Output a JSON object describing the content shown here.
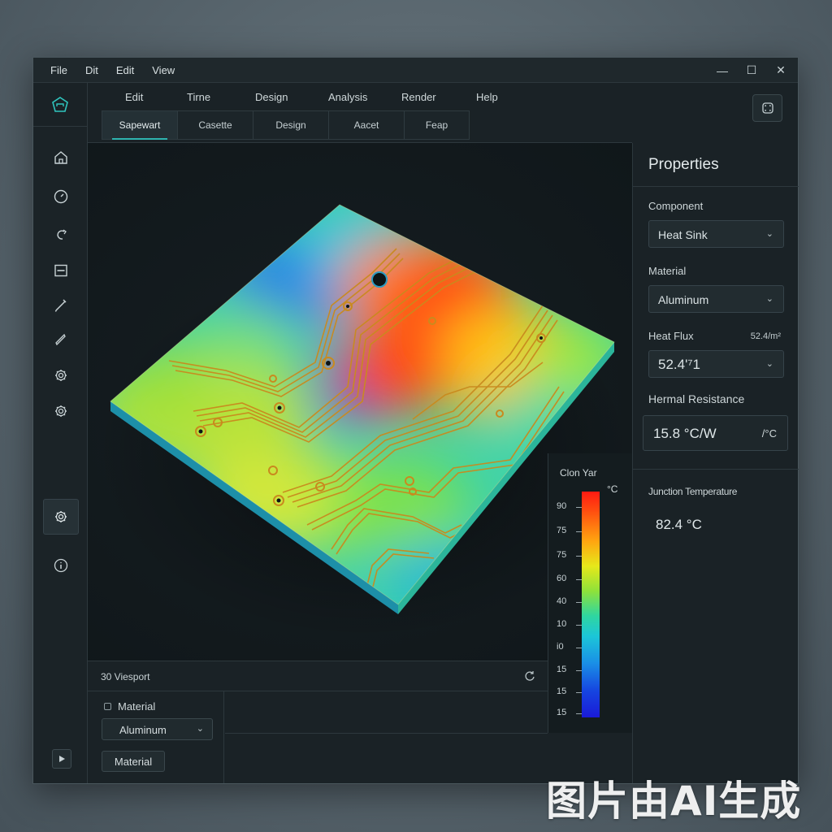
{
  "titlebar": {
    "menu": [
      "File",
      "Dit",
      "Edit",
      "View"
    ],
    "controls": {
      "minimize": "—",
      "maximize": "☐",
      "close": "✕"
    }
  },
  "topmenu": [
    "Edit",
    "Tirne",
    "Design",
    "Analysis",
    "Render",
    "Help"
  ],
  "tabs": [
    "Sapewart",
    "Casette",
    "Design",
    "Aacet",
    "Feap"
  ],
  "active_tab": 0,
  "sidebar": {
    "icons": [
      "home-icon",
      "gauge-icon",
      "hook-icon",
      "panel-icon",
      "pen-icon",
      "pencil-icon",
      "gear-icon",
      "settings-icon",
      "active-settings-icon",
      "info-icon"
    ]
  },
  "viewport": {
    "footer_label": "30 Viesport"
  },
  "colorbar": {
    "title": "Clon Yar",
    "unit": "°C",
    "ticks": [
      "90",
      "75",
      "75",
      "60",
      "40",
      "10",
      "i0",
      "15",
      "15",
      "15"
    ],
    "gradient_colors": [
      "#ff1a12",
      "#ffa510",
      "#e6e81a",
      "#2fd6a0",
      "#1a8fe6",
      "#1a1ad8"
    ]
  },
  "bottom_panel": {
    "checkbox_label": "Material",
    "select_value": "Aluminum",
    "button_label": "Material"
  },
  "properties": {
    "title": "Properties",
    "component": {
      "label": "Component",
      "value": "Heat Sink"
    },
    "material": {
      "label": "Material",
      "value": "Aluminum"
    },
    "heat_flux": {
      "label": "Heat Flux",
      "unit": "52.4/m²",
      "value": "52.4'⁷1"
    },
    "thermal_resistance": {
      "label": "Hermal Resistance",
      "value": "15.8 °C/W",
      "unit": "/°C"
    },
    "junction_temperature": {
      "label": "Junction Temperature",
      "value": "82.4 °C"
    }
  },
  "watermark": "图片由AI生成",
  "colors": {
    "accent": "#2fb5b0",
    "window_bg": "#1a2226",
    "border": "#2d383d"
  }
}
